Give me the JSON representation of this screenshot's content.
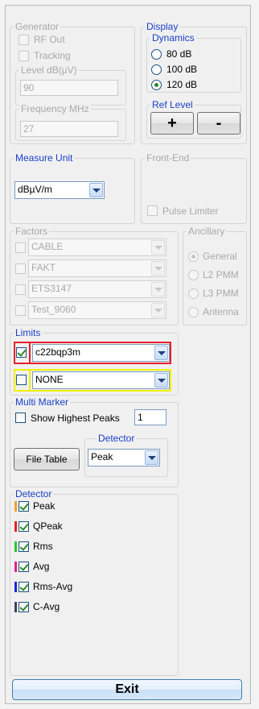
{
  "generator": {
    "title": "Generator",
    "rf_out": "RF Out",
    "tracking": "Tracking",
    "level_legend": "Level dB(µV)",
    "level_value": "90",
    "freq_legend": "Frequency MHz",
    "freq_value": "27"
  },
  "display": {
    "title": "Display",
    "dynamics_title": "Dynamics",
    "dynamics_options": [
      "80 dB",
      "100 dB",
      "120 dB"
    ],
    "dynamics_selected": "120 dB",
    "ref_level_title": "Ref Level",
    "plus_label": "+",
    "minus_label": "-"
  },
  "measure_unit": {
    "title": "Measure Unit",
    "value": "dBµV/m"
  },
  "front_end": {
    "title": "Front-End",
    "pulse_limiter": "Pulse Limiter"
  },
  "factors": {
    "title": "Factors",
    "items": [
      "CABLE",
      "FAKT",
      "ETS3147",
      "Test_9060"
    ]
  },
  "ancillary": {
    "title": "Ancillary",
    "options": [
      "General",
      "L2 PMM",
      "L3 PMM",
      "Antenna"
    ],
    "selected": "General"
  },
  "limits": {
    "title": "Limits",
    "limit1": {
      "value": "c22bqp3m",
      "checked": true,
      "color": "#e8202a"
    },
    "limit2": {
      "value": "NONE",
      "checked": false,
      "color": "#f0f000"
    }
  },
  "multi_marker": {
    "title": "Multi Marker",
    "show_highest_peaks": "Show Highest Peaks",
    "peaks_count": "1",
    "file_table": "File Table",
    "detector_title": "Detector",
    "detector_value": "Peak"
  },
  "detector": {
    "title": "Detector",
    "items": [
      {
        "label": "Peak",
        "color": "#f0a030"
      },
      {
        "label": "QPeak",
        "color": "#e82020"
      },
      {
        "label": "Rms",
        "color": "#28c828"
      },
      {
        "label": "Avg",
        "color": "#e0208c"
      },
      {
        "label": "Rms-Avg",
        "color": "#1828d8"
      },
      {
        "label": "C-Avg",
        "color": "#404060"
      }
    ]
  },
  "exit_label": "Exit",
  "icons": {
    "check": "check-icon",
    "dropdown": "chevron-down-icon"
  }
}
